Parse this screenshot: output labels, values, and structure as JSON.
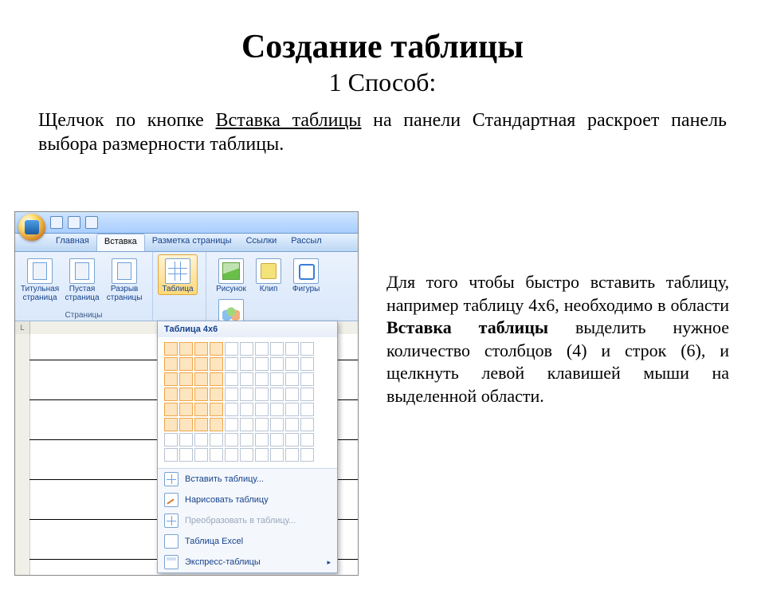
{
  "title": "Создание таблицы",
  "subtitle": "1 Способ:",
  "intro_pre": "Щелчок по кнопке ",
  "intro_ul": "Вставка таблицы",
  "intro_post": " на панели Стандартная раскроет панель выбора размерности таблицы.",
  "right_p1": "Для того чтобы быстро вставить таблицу, например таблицу 4х6, необходимо в области ",
  "right_b": "Вставка таблицы",
  "right_p2": " выделить нужное количество столбцов (4) и строк (6), и щелкнуть левой клавишей мыши на выделенной области.",
  "tabs": {
    "home": "Главная",
    "insert": "Вставка",
    "layout": "Разметка страницы",
    "refs": "Ссылки",
    "mail": "Рассыл"
  },
  "ribbon": {
    "pages_group": "Страницы",
    "cover": "Титульная страница",
    "blank": "Пустая страница",
    "break": "Разрыв страницы",
    "table": "Таблица",
    "picture": "Рисунок",
    "clip": "Клип",
    "shapes": "Фигуры",
    "smartart": "SmartArt"
  },
  "ruler_label": "L",
  "dropdown": {
    "caption": "Таблица 4x6",
    "insert": "Вставить таблицу...",
    "draw": "Нарисовать таблицу",
    "convert": "Преобразовать в таблицу...",
    "excel": "Таблица Excel",
    "express": "Экспресс-таблицы"
  },
  "grid": {
    "cols": 10,
    "rows": 8,
    "sel_cols": 4,
    "sel_rows": 6
  }
}
